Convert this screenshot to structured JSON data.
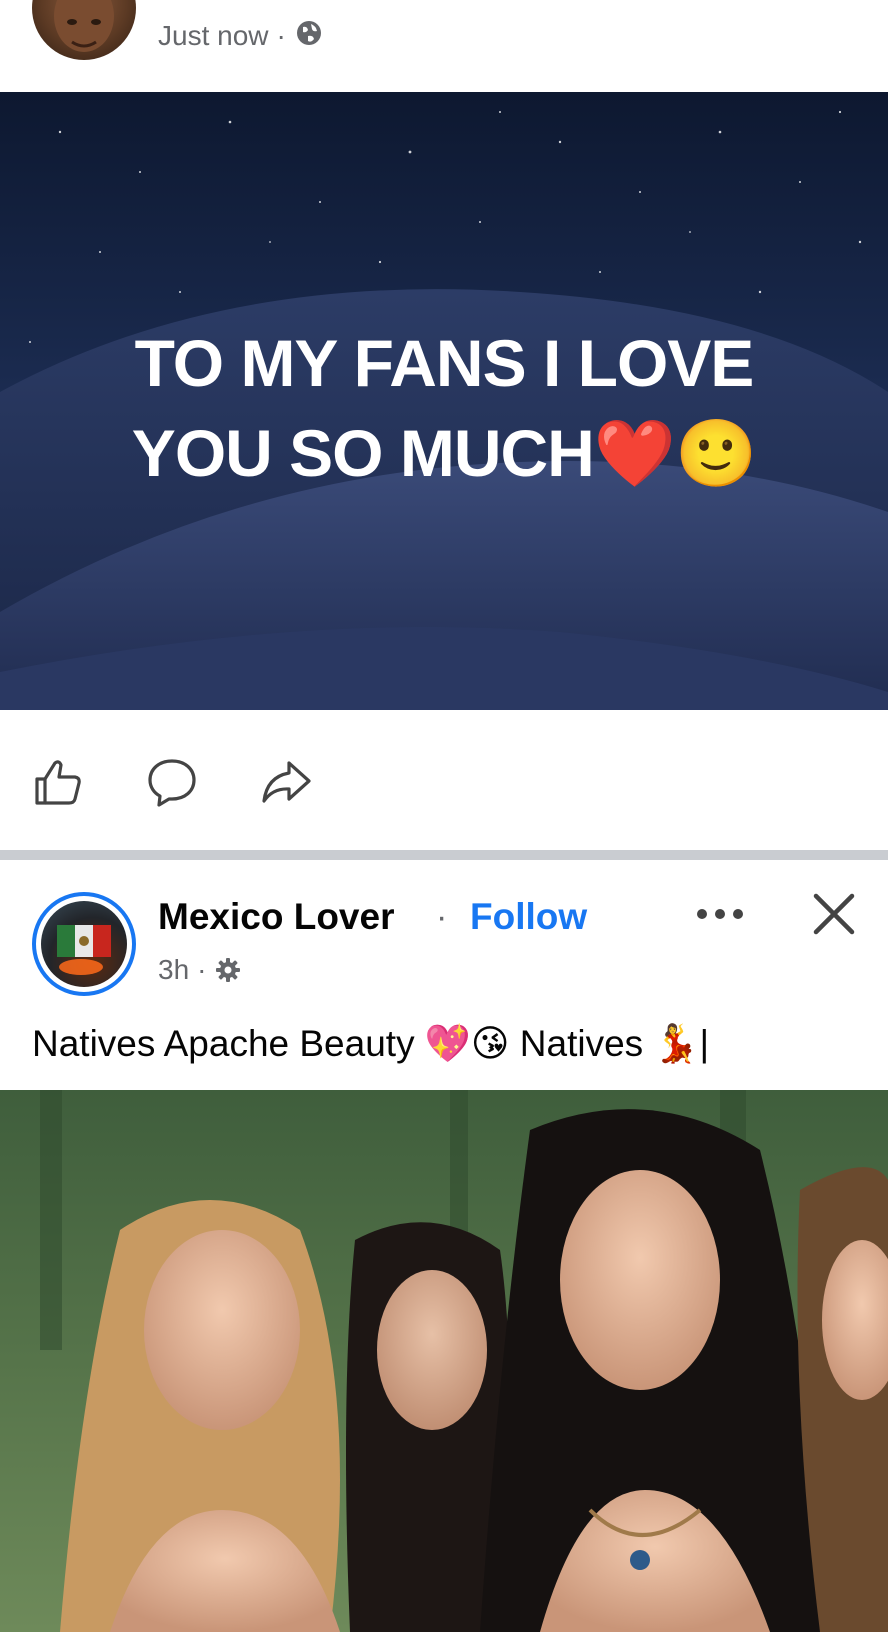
{
  "post1": {
    "timestamp": "Just now",
    "separator": "·",
    "privacy_icon": "globe-icon",
    "text_lines": [
      "TO MY FANS I LOVE",
      "YOU SO MUCH❤️🙂"
    ],
    "actions": {
      "like_icon": "thumbs-up-icon",
      "comment_icon": "comment-icon",
      "share_icon": "share-icon"
    }
  },
  "post2": {
    "page_name": "Mexico Lover",
    "name_separator": "·",
    "follow_label": "Follow",
    "time": "3h",
    "meta_separator": "·",
    "audience_icon": "gear-icon",
    "caption": "Natives Apache Beauty 💖😘 Natives 💃|",
    "more_icon": "more-dots-icon",
    "close_icon": "close-icon"
  },
  "colors": {
    "accent": "#1877f2",
    "secondary_text": "#65676b",
    "divider": "#c9ccd1"
  }
}
